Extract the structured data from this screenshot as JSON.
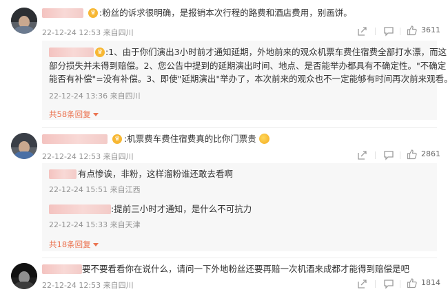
{
  "comments": [
    {
      "text": ":粉丝的诉求很明确，是报销本次行程的路费和酒店费用，别画饼。",
      "time": "22-12-24 12:53 来自四川",
      "likes": "3611",
      "replies": [
        {
          "lines": [
            ":1、由于你们演出3小时前才通知延期，外地前来的观众机票车费住宿费全部打水漂，而这",
            "部分损失并未得到赔偿。2、您公告中提到的延期演出时间、地点、是否能举办都具有不确定性。\"不确定",
            "能否有补偿\"=没有补偿。3、即使\"延期演出\"举办了，本次前来的观众也不一定能够有时间再次前来观看。"
          ],
          "time": "22-12-24 13:36 来自四川"
        }
      ],
      "more": "共58条回复"
    },
    {
      "text": ":机票费车费住宿费真的比你门票贵",
      "time": "22-12-24 12:53 来自四川",
      "likes": "2861",
      "replies": [
        {
          "text": "有点惨诶，非粉，这样溜粉谁还敢去看啊",
          "time": "22-12-24 15:51 来自江西"
        },
        {
          "text": ":提前三小时才通知，是什么不可抗力",
          "time": "22-12-24 15:33 来自天津"
        }
      ],
      "more": "共18条回复"
    },
    {
      "text": "要不要看看你在说什么，请问一下外地粉丝还要再赔一次机酒来成都才能得到赔偿是吧",
      "time": "22-12-24 12:53 来自四川",
      "likes": "1814"
    }
  ],
  "icons": {
    "share": "share-icon",
    "comment": "comment-icon",
    "like": "thumbs-up-icon"
  },
  "colors": {
    "link": "#eb7350",
    "meta": "#939393",
    "reply_bg": "#f7f7f7"
  }
}
